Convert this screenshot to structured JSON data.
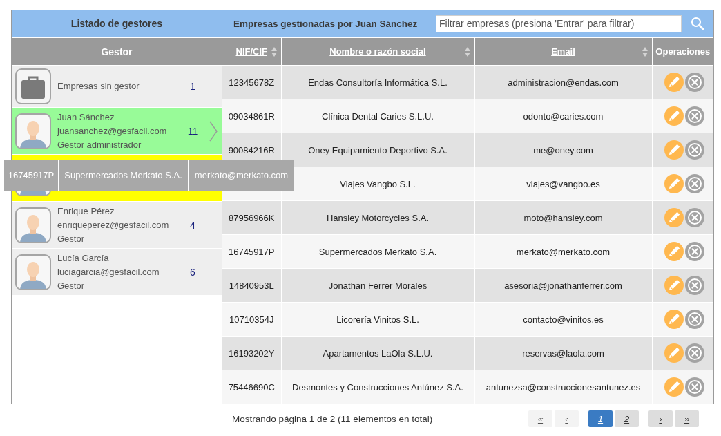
{
  "managers_panel": {
    "title": "Listado de gestores",
    "column_header": "Gestor",
    "items": [
      {
        "kind": "unassigned",
        "name": "Empresas sin gestor",
        "count": "1",
        "selected": false,
        "drop_target": false
      },
      {
        "kind": "manager",
        "name": "Juan Sánchez",
        "email": "juansanchez@gesfacil.com",
        "role": "Gestor administrador",
        "count": "11",
        "selected": true,
        "drop_target": false
      },
      {
        "kind": "manager",
        "selected": false,
        "drop_target": true
      },
      {
        "kind": "manager",
        "name": "Enrique Pérez",
        "email": "enriqueperez@gesfacil.com",
        "role": "Gestor",
        "count": "4",
        "selected": false,
        "drop_target": false
      },
      {
        "kind": "manager",
        "name": "Lucía García",
        "email": "luciagarcia@gesfacil.com",
        "role": "Gestor",
        "count": "6",
        "selected": false,
        "drop_target": false
      }
    ]
  },
  "companies_panel": {
    "title": "Empresas gestionadas por Juan Sánchez",
    "filter": {
      "placeholder": "Filtrar empresas (presiona 'Entrar' para filtrar)"
    },
    "columns": [
      {
        "label": "NIF/CIF",
        "sortable": true
      },
      {
        "label": "Nombre o razón social",
        "sortable": true
      },
      {
        "label": "Email",
        "sortable": true
      },
      {
        "label": "Operaciones",
        "sortable": false
      }
    ],
    "rows": [
      {
        "nif": "12345678Z",
        "name": "Endas Consultoría Informática S.L.",
        "email": "administracion@endas.com"
      },
      {
        "nif": "09034861R",
        "name": "Clínica Dental Caries S.L.U.",
        "email": "odonto@caries.com"
      },
      {
        "nif": "90084216R",
        "name": "Oney Equipamiento Deportivo S.A.",
        "email": "me@oney.com"
      },
      {
        "name": "Viajes Vangbo S.L.",
        "email": "viajes@vangbo.es"
      },
      {
        "nif": "87956966K",
        "name": "Hansley Motorcycles S.A.",
        "email": "moto@hansley.com"
      },
      {
        "nif": "16745917P",
        "name": "Supermercados Merkato S.A.",
        "email": "merkato@merkato.com"
      },
      {
        "nif": "14840953L",
        "name": "Jonathan Ferrer Morales",
        "email": "asesoria@jonathanferrer.com"
      },
      {
        "nif": "10710354J",
        "name": "Licorería Vinitos S.L.",
        "email": "contacto@vinitos.es"
      },
      {
        "nif": "16193202Y",
        "name": "Apartamentos LaOla S.L.U.",
        "email": "reservas@laola.com"
      },
      {
        "nif": "75446690C",
        "name": "Desmontes y Construcciones Antúnez S.A.",
        "email": "antunezsa@construccionesantunez.es"
      }
    ]
  },
  "drag_preview": {
    "cells": [
      "16745917P",
      "Supermercados Merkato S.A.",
      "merkato@merkato.com"
    ]
  },
  "pagination": {
    "summary": "Mostrando página 1 de 2 (11 elementos en total)",
    "back_buttons": [
      {
        "label": "«",
        "disabled": true
      },
      {
        "label": "‹",
        "disabled": true
      }
    ],
    "pages": [
      {
        "label": "1",
        "selected": true
      },
      {
        "label": "2",
        "selected": false
      }
    ],
    "forward_buttons": [
      {
        "label": "›",
        "disabled": false
      },
      {
        "label": "»",
        "disabled": false
      }
    ]
  }
}
